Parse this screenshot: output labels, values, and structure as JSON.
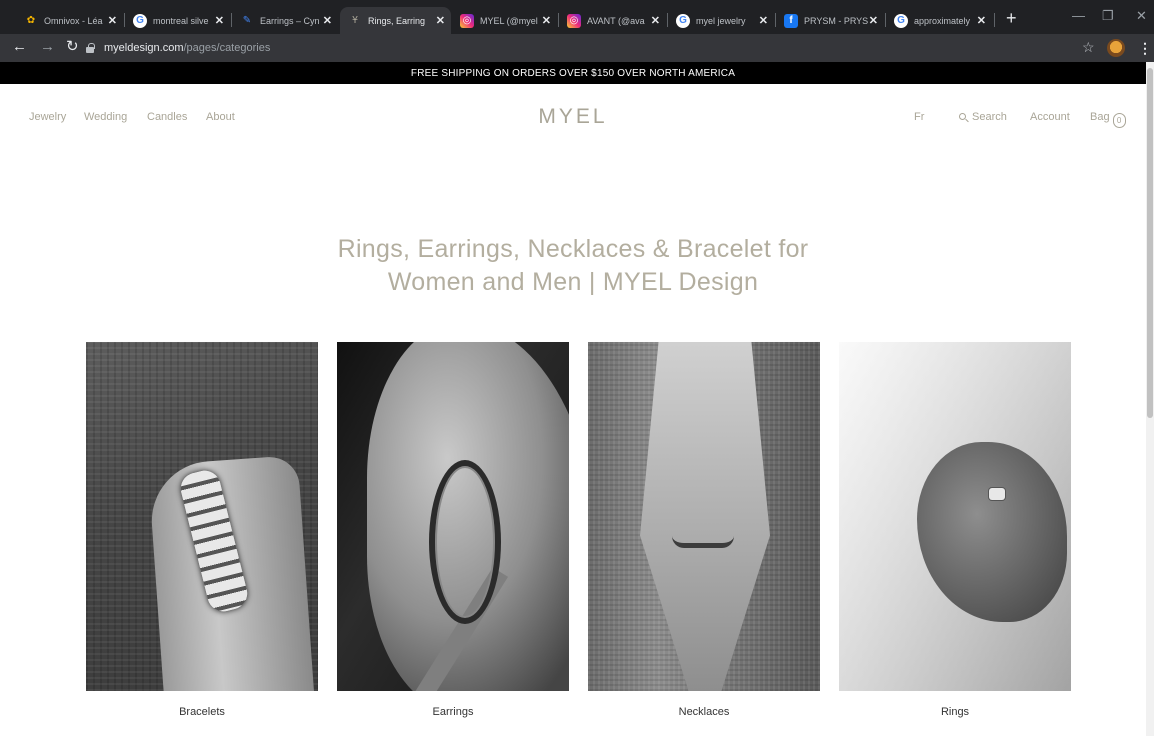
{
  "browser": {
    "tabs": [
      {
        "title": "Omnivox - Léa",
        "favicon_color": "#f4b400",
        "icon": "omnivox-icon",
        "active": false
      },
      {
        "title": "montreal silve",
        "favicon_color": "#4285f4",
        "icon": "google-icon",
        "active": false
      },
      {
        "title": "Earrings – Cyn",
        "favicon_color": "#4285f4",
        "icon": "feather-icon",
        "active": false
      },
      {
        "title": "Rings, Earring",
        "favicon_color": "#a9a597",
        "icon": "myel-icon",
        "active": true
      },
      {
        "title": "MYEL (@myel",
        "favicon_color": "#d6249f",
        "icon": "instagram-icon",
        "active": false
      },
      {
        "title": "AVANT (@ava",
        "favicon_color": "#d6249f",
        "icon": "instagram-icon",
        "active": false
      },
      {
        "title": "myel jewelry",
        "favicon_color": "#4285f4",
        "icon": "google-icon",
        "active": false
      },
      {
        "title": "PRYSM - PRYS",
        "favicon_color": "#1877f2",
        "icon": "facebook-icon",
        "active": false
      },
      {
        "title": "approximately",
        "favicon_color": "#4285f4",
        "icon": "google-icon",
        "active": false
      }
    ],
    "url_host": "myeldesign.com",
    "url_path": "/pages/categories"
  },
  "announcement": "FREE SHIPPING ON ORDERS OVER $150 OVER NORTH AMERICA",
  "header": {
    "nav_left": [
      "Jewelry",
      "Wedding",
      "Candles",
      "About"
    ],
    "logo": "MYEL",
    "lang": "Fr",
    "search": "Search",
    "account": "Account",
    "bag": "Bag",
    "bag_count": "0"
  },
  "hero": {
    "line1": "Rings, Earrings, Necklaces & Bracelet for",
    "line2": "Women and Men | MYEL Design"
  },
  "categories": [
    {
      "label": "Bracelets"
    },
    {
      "label": "Earrings"
    },
    {
      "label": "Necklaces"
    },
    {
      "label": "Rings"
    }
  ],
  "colors": {
    "accent_text": "#a9a597",
    "announcement_bg": "#000000",
    "browser_chrome": "#202124"
  }
}
